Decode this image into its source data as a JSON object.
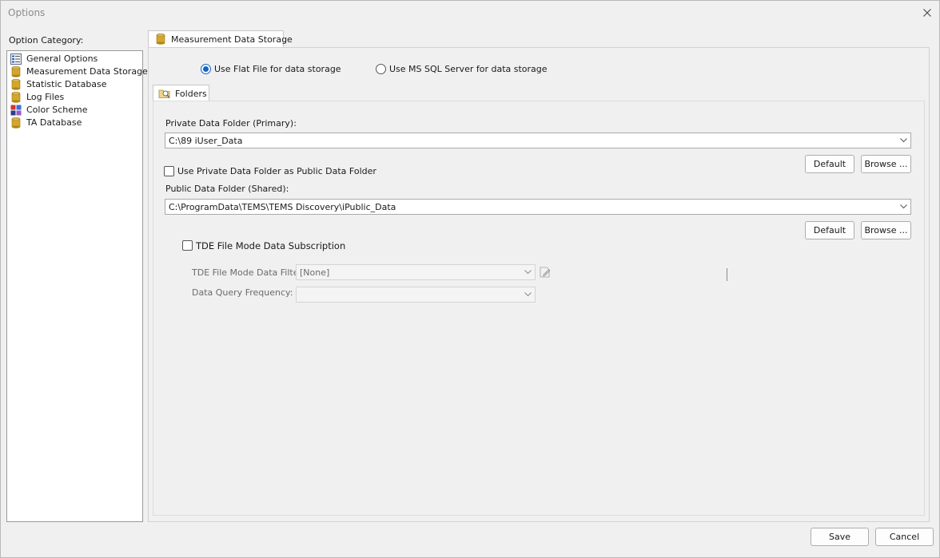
{
  "window": {
    "title": "Options"
  },
  "sidebar": {
    "header": "Option Category:",
    "items": [
      {
        "label": "General Options",
        "icon": "settings-list-icon"
      },
      {
        "label": "Measurement Data Storage",
        "icon": "database-icon"
      },
      {
        "label": "Statistic Database",
        "icon": "database-icon"
      },
      {
        "label": "Log Files",
        "icon": "database-icon"
      },
      {
        "label": "Color Scheme",
        "icon": "color-palette-icon"
      },
      {
        "label": "TA Database",
        "icon": "database-icon"
      }
    ]
  },
  "main": {
    "tab_label": "Measurement Data Storage",
    "storage": {
      "flat_file_label": "Use Flat File for data storage",
      "flat_file_selected": true,
      "sql_label": "Use MS SQL Server for data storage",
      "sql_selected": false
    },
    "folders": {
      "tab_label": "Folders",
      "private_label": "Private Data Folder (Primary):",
      "private_value": "C:\\89 iUser_Data",
      "default_label": "Default",
      "browse_label": "Browse ...",
      "use_private_label": "Use Private Data Folder as Public Data Folder",
      "use_private_checked": false,
      "public_label": "Public Data Folder (Shared):",
      "public_value": "C:\\ProgramData\\TEMS\\TEMS Discovery\\iPublic_Data",
      "tde_label": "TDE File Mode Data Subscription",
      "tde_checked": false,
      "filter_label": "TDE File Mode Data Filter:",
      "filter_value": "[None]",
      "frequency_label": "Data Query Frequency:",
      "frequency_value": ""
    }
  },
  "footer": {
    "save_label": "Save",
    "cancel_label": "Cancel"
  },
  "colors": {
    "accent": "#1463c6",
    "database_icon": "#d4a72c"
  }
}
